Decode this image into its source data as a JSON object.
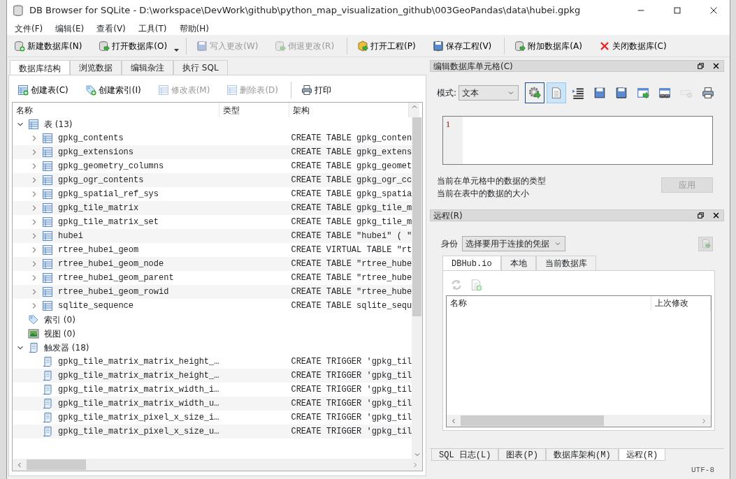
{
  "window": {
    "title": "DB Browser for SQLite - D:\\workspace\\DevWork\\github\\python_map_visualization_github\\003GeoPandas\\data\\hubei.gpkg"
  },
  "menu": [
    "文件(F)",
    "编辑(E)",
    "查看(V)",
    "工具(T)",
    "帮助(H)"
  ],
  "toolbar": [
    {
      "label": "新建数据库(N)",
      "disabled": false,
      "separator_before": false
    },
    {
      "label": "打开数据库(O)",
      "disabled": false,
      "separator_before": false,
      "dropdown": true
    },
    {
      "label": "写入更改(W)",
      "disabled": true,
      "separator_before": true
    },
    {
      "label": "倒退更改(R)",
      "disabled": true,
      "separator_before": false
    },
    {
      "label": "打开工程(P)",
      "disabled": false,
      "separator_before": true
    },
    {
      "label": "保存工程(V)",
      "disabled": false,
      "separator_before": false
    },
    {
      "label": "附加数据库(A)",
      "disabled": false,
      "separator_before": true
    },
    {
      "label": "关闭数据库(C)",
      "disabled": false,
      "separator_before": false
    }
  ],
  "tabs": [
    {
      "label": "数据库结构",
      "selected": true
    },
    {
      "label": "浏览数据",
      "selected": false
    },
    {
      "label": "编辑杂注",
      "selected": false
    },
    {
      "label": "执行 SQL",
      "selected": false
    }
  ],
  "structure_toolbar": [
    {
      "label": "创建表(C)",
      "disabled": false,
      "separator_before": false
    },
    {
      "label": "创建索引(I)",
      "disabled": false,
      "separator_before": false
    },
    {
      "label": "修改表(M)",
      "disabled": true,
      "separator_before": false
    },
    {
      "label": "删除表(D)",
      "disabled": true,
      "separator_before": false
    },
    {
      "label": "打印",
      "disabled": false,
      "separator_before": true
    }
  ],
  "tree": {
    "columns": [
      "名称",
      "类型",
      "架构"
    ],
    "items": [
      {
        "label": "表 (13)",
        "kind": "tables",
        "expanded": true,
        "children": [
          {
            "label": "gpkg_contents",
            "kind": "table",
            "expanded": false,
            "schema": "CREATE TABLE gpkg_conten"
          },
          {
            "label": "gpkg_extensions",
            "kind": "table",
            "expanded": false,
            "schema": "CREATE TABLE gpkg_extens"
          },
          {
            "label": "gpkg_geometry_columns",
            "kind": "table",
            "expanded": false,
            "schema": "CREATE TABLE gpkg_geomet"
          },
          {
            "label": "gpkg_ogr_contents",
            "kind": "table",
            "expanded": false,
            "schema": "CREATE TABLE gpkg_ogr_cc"
          },
          {
            "label": "gpkg_spatial_ref_sys",
            "kind": "table",
            "expanded": false,
            "schema": "CREATE TABLE gpkg_spatia"
          },
          {
            "label": "gpkg_tile_matrix",
            "kind": "table",
            "expanded": false,
            "schema": "CREATE TABLE gpkg_tile_m"
          },
          {
            "label": "gpkg_tile_matrix_set",
            "kind": "table",
            "expanded": false,
            "schema": "CREATE TABLE gpkg_tile_m"
          },
          {
            "label": "hubei",
            "kind": "table",
            "expanded": false,
            "schema": "CREATE TABLE \"hubei\" ( \""
          },
          {
            "label": "rtree_hubei_geom",
            "kind": "table",
            "expanded": false,
            "schema": "CREATE VIRTUAL TABLE \"rt"
          },
          {
            "label": "rtree_hubei_geom_node",
            "kind": "table",
            "expanded": false,
            "schema": "CREATE TABLE \"rtree_hube"
          },
          {
            "label": "rtree_hubei_geom_parent",
            "kind": "table",
            "expanded": false,
            "schema": "CREATE TABLE \"rtree_hube"
          },
          {
            "label": "rtree_hubei_geom_rowid",
            "kind": "table",
            "expanded": false,
            "schema": "CREATE TABLE \"rtree_hube"
          },
          {
            "label": "sqlite_sequence",
            "kind": "table",
            "expanded": false,
            "schema": "CREATE TABLE sqlite_sequ"
          }
        ]
      },
      {
        "label": "索引 (0)",
        "kind": "indexes"
      },
      {
        "label": "视图 (0)",
        "kind": "views"
      },
      {
        "label": "触发器 (18)",
        "kind": "triggers",
        "expanded": true,
        "children": [
          {
            "label": "gpkg_tile_matrix_matrix_height_…",
            "kind": "trigger",
            "schema": "CREATE TRIGGER 'gpkg_til"
          },
          {
            "label": "gpkg_tile_matrix_matrix_height_…",
            "kind": "trigger",
            "schema": "CREATE TRIGGER 'gpkg_til"
          },
          {
            "label": "gpkg_tile_matrix_matrix_width_i…",
            "kind": "trigger",
            "schema": "CREATE TRIGGER 'gpkg_til"
          },
          {
            "label": "gpkg_tile_matrix_matrix_width_u…",
            "kind": "trigger",
            "schema": "CREATE TRIGGER 'gpkg_til"
          },
          {
            "label": "gpkg_tile_matrix_pixel_x_size_i…",
            "kind": "trigger",
            "schema": "CREATE TRIGGER 'gpkg_til"
          },
          {
            "label": "gpkg_tile_matrix_pixel_x_size_u…",
            "kind": "trigger",
            "schema": "CREATE TRIGGER 'gpkg_til"
          }
        ]
      }
    ]
  },
  "cell_editor": {
    "title": "编辑数据库单元格(C)",
    "mode_label": "模式:",
    "mode": "文本",
    "tools": [
      {
        "selected": false,
        "disabled": false
      },
      {
        "selected": true,
        "disabled": false
      },
      {
        "selected": false,
        "disabled": false
      },
      {
        "selected": false,
        "disabled": false
      },
      {
        "selected": false,
        "disabled": false
      },
      {
        "selected": false,
        "disabled": false
      },
      {
        "selected": false,
        "disabled": false
      },
      {
        "selected": false,
        "disabled": true
      },
      {
        "selected": false,
        "disabled": false
      }
    ],
    "line_number": "1",
    "type_info": "当前在单元格中的数据的类型",
    "size_info": "当前在表中的数据的大小",
    "apply": {
      "label": "应用",
      "disabled": true
    }
  },
  "remote": {
    "title": "远程(R)",
    "identity_label": "身份",
    "identity": "选择要用于连接的凭据",
    "tabs": [
      {
        "label": "DBHub.io",
        "selected": true
      },
      {
        "label": "本地",
        "selected": false
      },
      {
        "label": "当前数据库",
        "selected": false
      }
    ],
    "columns": [
      "名称",
      "上次修改"
    ]
  },
  "bottom_tabs": [
    {
      "label": "SQL 日志(L)",
      "selected": false
    },
    {
      "label": "图表(P)",
      "selected": false
    },
    {
      "label": "数据库架构(M)",
      "selected": false
    },
    {
      "label": "远程(R)",
      "selected": true
    }
  ],
  "status_bar": {
    "encoding": "UTF-8"
  }
}
